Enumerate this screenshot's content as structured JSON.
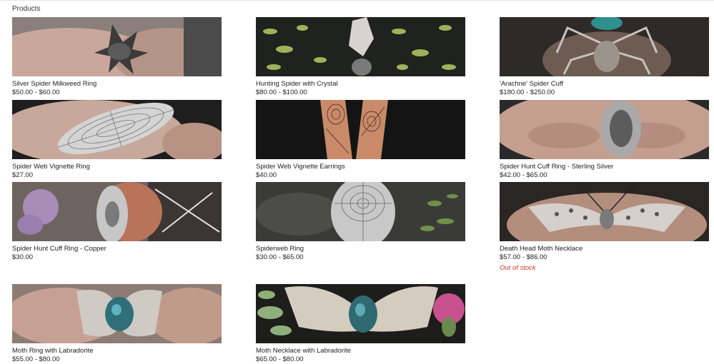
{
  "section": {
    "heading": "Products"
  },
  "products": [
    {
      "title": "Silver Spider Milkweed Ring",
      "price": "$50.00 - $60.00"
    },
    {
      "title": "Hunting Spider with Crystal",
      "price": "$80.00 - $100.00"
    },
    {
      "title": "'Arachne' Spider Cuff",
      "price": "$180.00 - $250.00"
    },
    {
      "title": "Spider Web Vignette Ring",
      "price": "$27.00"
    },
    {
      "title": "Spider Web Vignette Earrings",
      "price": "$40.00"
    },
    {
      "title": "Spider Hunt Cuff Ring - Sterling Silver",
      "price": "$42.00 - $65.00"
    },
    {
      "title": "Spider Hunt Cuff Ring - Copper",
      "price": "$30.00"
    },
    {
      "title": "Spiderweb Ring",
      "price": "$30.00 - $65.00"
    },
    {
      "title": "Death Head Moth Necklace",
      "price": "$57.00 - $86.00",
      "stock_status": "Out of stock"
    },
    {
      "title": "Moth Ring with Labradorite",
      "price": "$55.00 - $80.00"
    },
    {
      "title": "Moth Necklace with Labradorite",
      "price": "$65.00 - $80.00"
    }
  ],
  "colors": {
    "out_of_stock": "#d0342c",
    "text": "#222222"
  }
}
